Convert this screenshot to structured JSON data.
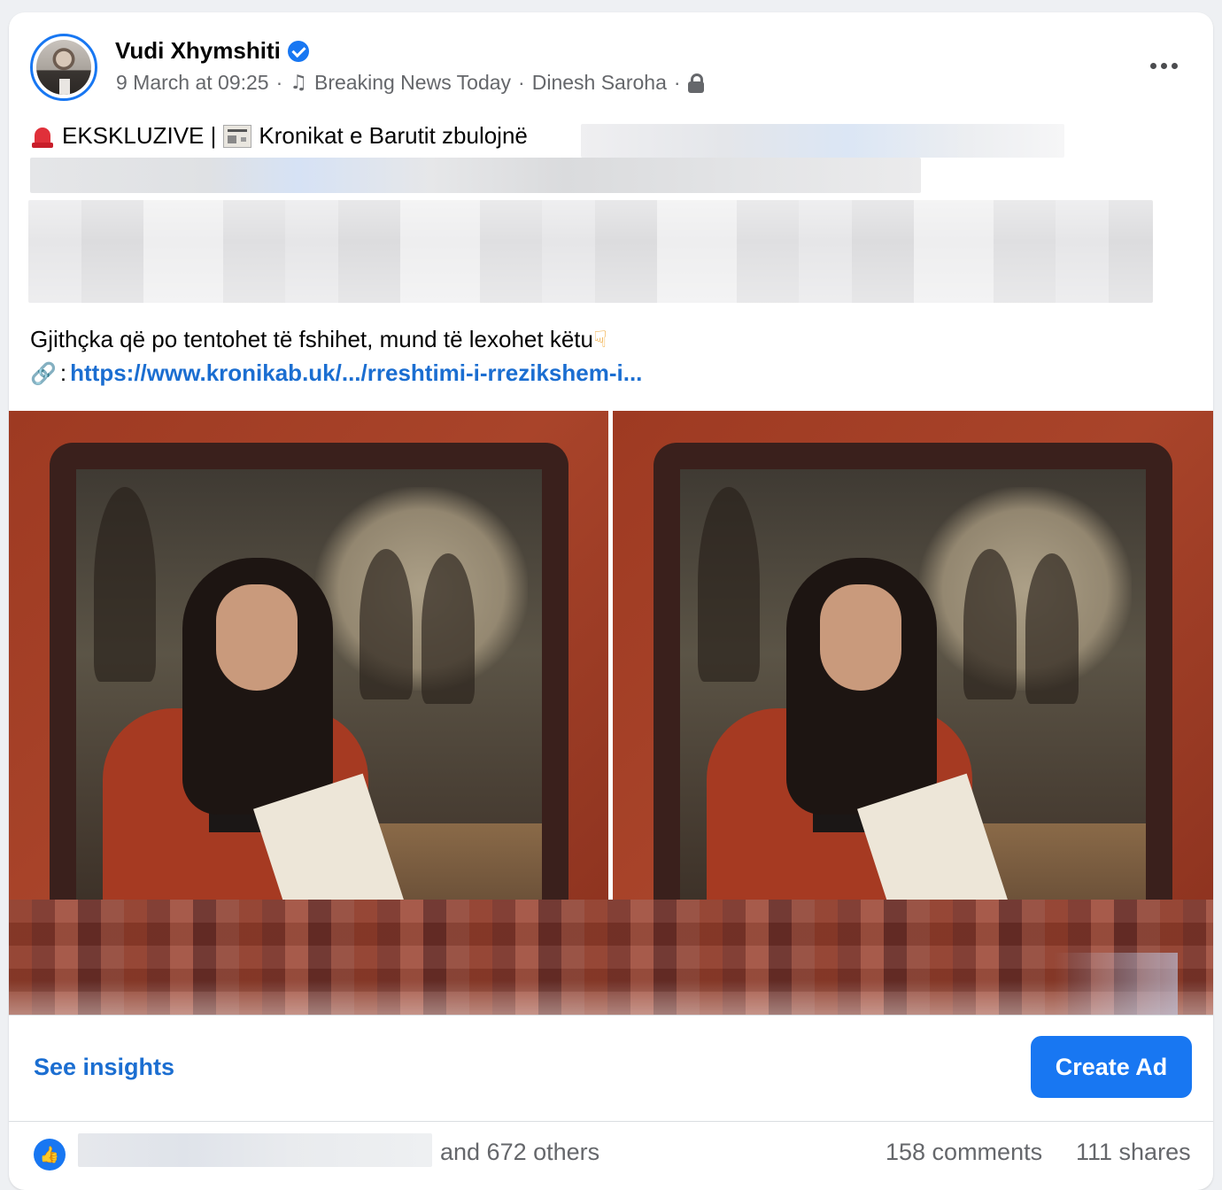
{
  "post": {
    "author": "Vudi Xhymshiti",
    "date": "9 March at 09:25",
    "sep": "·",
    "music_label": "Breaking News Today",
    "music_artist": "Dinesh Saroha",
    "line1_prefix": "EKSKLUZIVE |",
    "line1_text": "Kronikat e Barutit zbulojnë",
    "line2": "Gjithçka që po tentohet të fshihet, mund të lexohet këtu",
    "link_colon": ":",
    "link_text": "https://www.kronikab.uk/.../rreshtimi-i-rrezikshem-i..."
  },
  "icons": {
    "avatar": "profile-photo",
    "verified": "verified-badge-icon",
    "music": "music-note-icon",
    "privacy": "lock-icon",
    "more": "more-options-icon",
    "siren": "siren-icon",
    "newspaper": "newspaper-icon",
    "pointing": "pointing-down-icon",
    "link": "link-icon",
    "like": "like-icon"
  },
  "actions": {
    "insights": "See insights",
    "create_ad": "Create Ad"
  },
  "reactions": {
    "others": "and 672 others",
    "comments": "158 comments",
    "shares": "111 shares"
  },
  "colors": {
    "accent": "#1877f2",
    "link": "#1b6ed1",
    "muted": "#65676b"
  }
}
